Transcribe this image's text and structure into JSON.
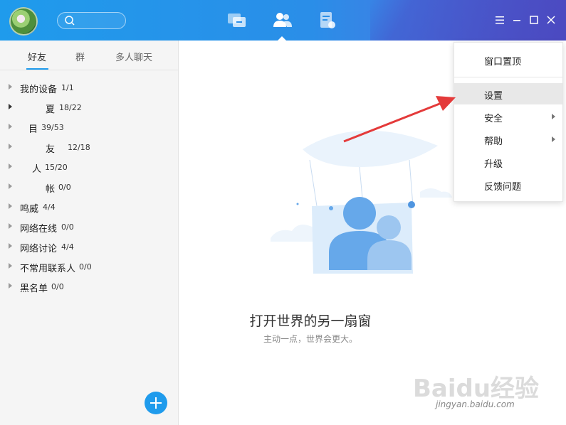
{
  "header": {
    "search_placeholder": "",
    "nav_icons": [
      "chat-icon",
      "contacts-icon",
      "document-icon"
    ],
    "active_nav": "contacts",
    "window_controls": [
      "menu-icon",
      "minimize-icon",
      "maximize-icon",
      "close-icon"
    ],
    "colors": {
      "accent": "#1f9bec",
      "accent_dark": "#5a55c8"
    }
  },
  "sidebar": {
    "tabs": [
      {
        "label": "好友",
        "active": true
      },
      {
        "label": "群",
        "active": false
      },
      {
        "label": "多人聊天",
        "active": false
      }
    ],
    "groups": [
      {
        "name": "我的设备",
        "count": "1/1"
      },
      {
        "name": "夏",
        "count": "18/22"
      },
      {
        "name": "目",
        "count": "39/53"
      },
      {
        "name": "友",
        "count": "12/18"
      },
      {
        "name": "人",
        "count": "15/20"
      },
      {
        "name": "帐",
        "count": "0/0"
      },
      {
        "name": "鸣威",
        "count": "4/4"
      },
      {
        "name": "网络在线",
        "count": "0/0"
      },
      {
        "name": "网络讨论",
        "count": "4/4"
      },
      {
        "name": "不常用联系人",
        "count": "0/0"
      },
      {
        "name": "黑名单",
        "count": "0/0"
      }
    ]
  },
  "main": {
    "headline": "打开世界的另一扇窗",
    "subline": "主动一点，世界会更大。"
  },
  "menu": {
    "items": [
      {
        "label": "窗口置顶",
        "submenu": false
      },
      {
        "label": "设置",
        "submenu": false,
        "highlighted": true
      },
      {
        "label": "安全",
        "submenu": true
      },
      {
        "label": "帮助",
        "submenu": true
      },
      {
        "label": "升级",
        "submenu": false
      },
      {
        "label": "反馈问题",
        "submenu": false
      }
    ]
  },
  "watermark": {
    "logo": "Baidu经验",
    "url": "jingyan.baidu.com"
  }
}
